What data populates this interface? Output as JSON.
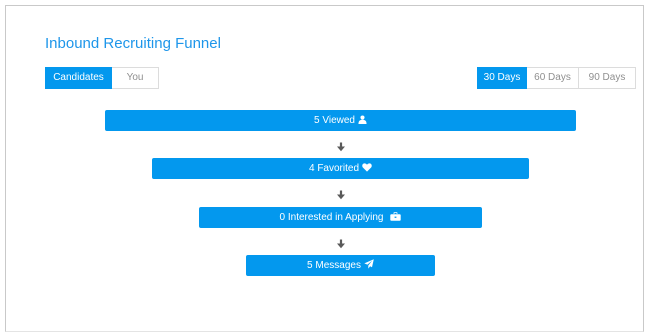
{
  "funnel": {
    "title": "Inbound Recruiting Funnel",
    "audience_toggle": {
      "options": [
        "Candidates",
        "You"
      ],
      "selected": "Candidates"
    },
    "range_toggle": {
      "options": [
        "30 Days",
        "60 Days",
        "90 Days"
      ],
      "selected": "30 Days"
    },
    "stages": [
      {
        "label": "5 Viewed",
        "icon": "user-icon"
      },
      {
        "label": "4 Favorited",
        "icon": "heart-icon"
      },
      {
        "label": "0 Interested in Applying",
        "icon": "briefcase-icon"
      },
      {
        "label": "5 Messages",
        "icon": "paper-plane-icon"
      }
    ]
  },
  "colors": {
    "accent": "#0398ee",
    "title": "#1e96ea",
    "arrow": "#5a5a5a",
    "inactive_text": "#8f8f8f",
    "border": "#dcdcdc"
  }
}
